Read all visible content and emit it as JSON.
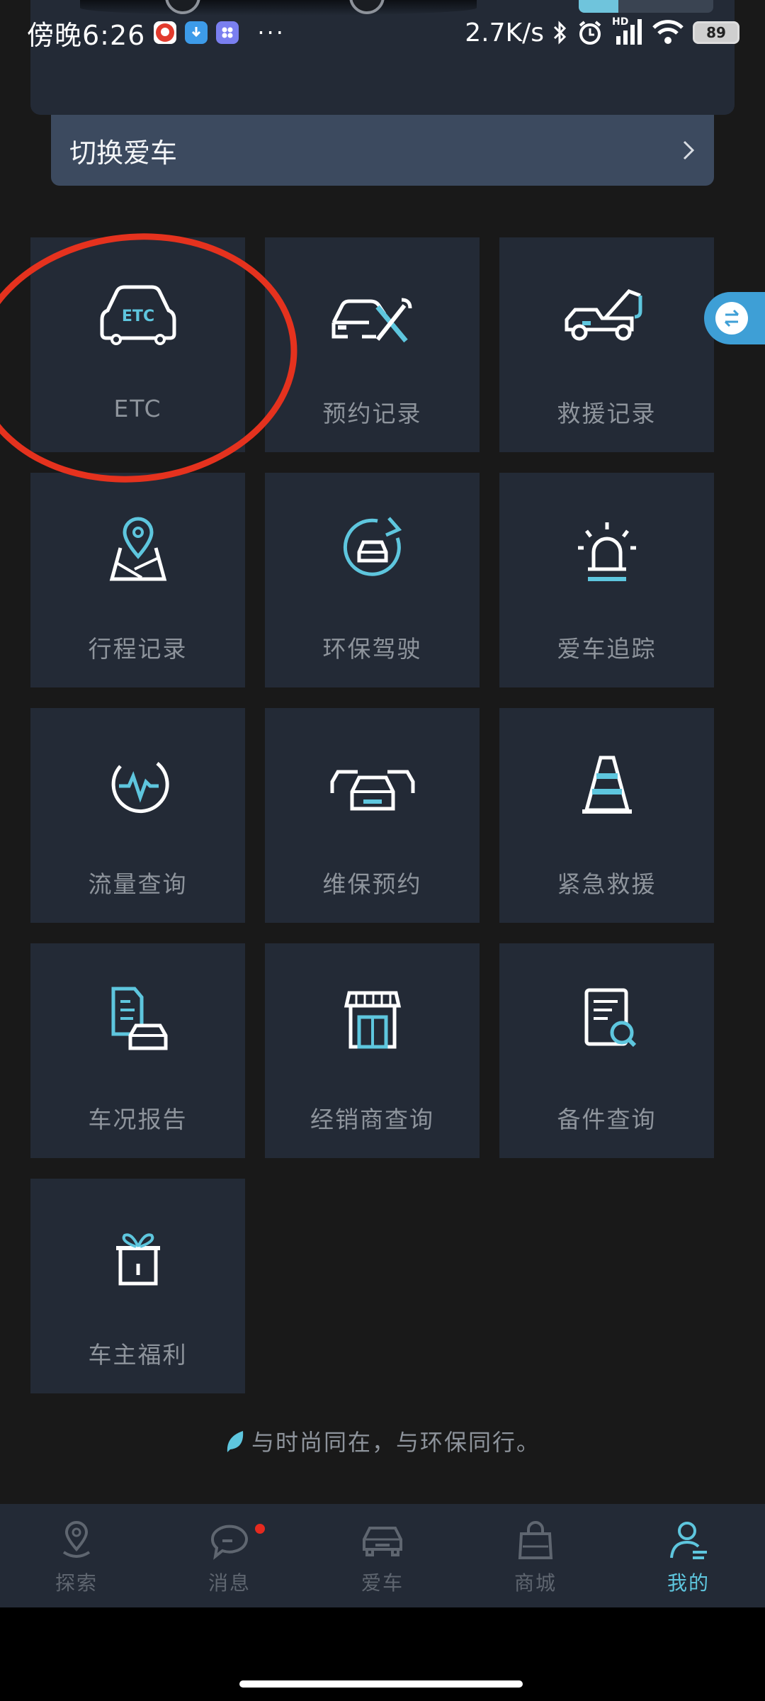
{
  "status_bar": {
    "time": "傍晚6:26",
    "speed": "2.7K/s",
    "signal_label": "HD",
    "battery": "89",
    "more": "···"
  },
  "switch_car": {
    "label": "切换爱车"
  },
  "grid": [
    {
      "label": "ETC",
      "icon": "etc-car-icon"
    },
    {
      "label": "预约记录",
      "icon": "car-repair-icon"
    },
    {
      "label": "救援记录",
      "icon": "tow-truck-icon"
    },
    {
      "label": "行程记录",
      "icon": "map-pin-icon"
    },
    {
      "label": "环保驾驶",
      "icon": "eco-drive-icon"
    },
    {
      "label": "爱车追踪",
      "icon": "alarm-light-icon"
    },
    {
      "label": "流量查询",
      "icon": "data-flow-icon"
    },
    {
      "label": "维保预约",
      "icon": "cars-service-icon"
    },
    {
      "label": "紧急救援",
      "icon": "traffic-cone-icon"
    },
    {
      "label": "车况报告",
      "icon": "car-report-icon"
    },
    {
      "label": "经销商查询",
      "icon": "store-icon"
    },
    {
      "label": "备件查询",
      "icon": "parts-search-icon"
    },
    {
      "label": "车主福利",
      "icon": "gift-icon"
    }
  ],
  "etc_icon_text": "ETC",
  "slogan": "与时尚同在，与环保同行。",
  "bottom_nav": [
    {
      "label": "探索",
      "icon": "location-icon",
      "active": false
    },
    {
      "label": "消息",
      "icon": "message-icon",
      "active": false,
      "badge": true
    },
    {
      "label": "爱车",
      "icon": "car-icon",
      "active": false
    },
    {
      "label": "商城",
      "icon": "shopping-bag-icon",
      "active": false
    },
    {
      "label": "我的",
      "icon": "profile-icon",
      "active": true
    }
  ],
  "colors": {
    "background": "#191919",
    "tile": "#232a36",
    "accent": "#5ec6de",
    "annotation": "#e5321e",
    "badge": "#e52a1f"
  }
}
